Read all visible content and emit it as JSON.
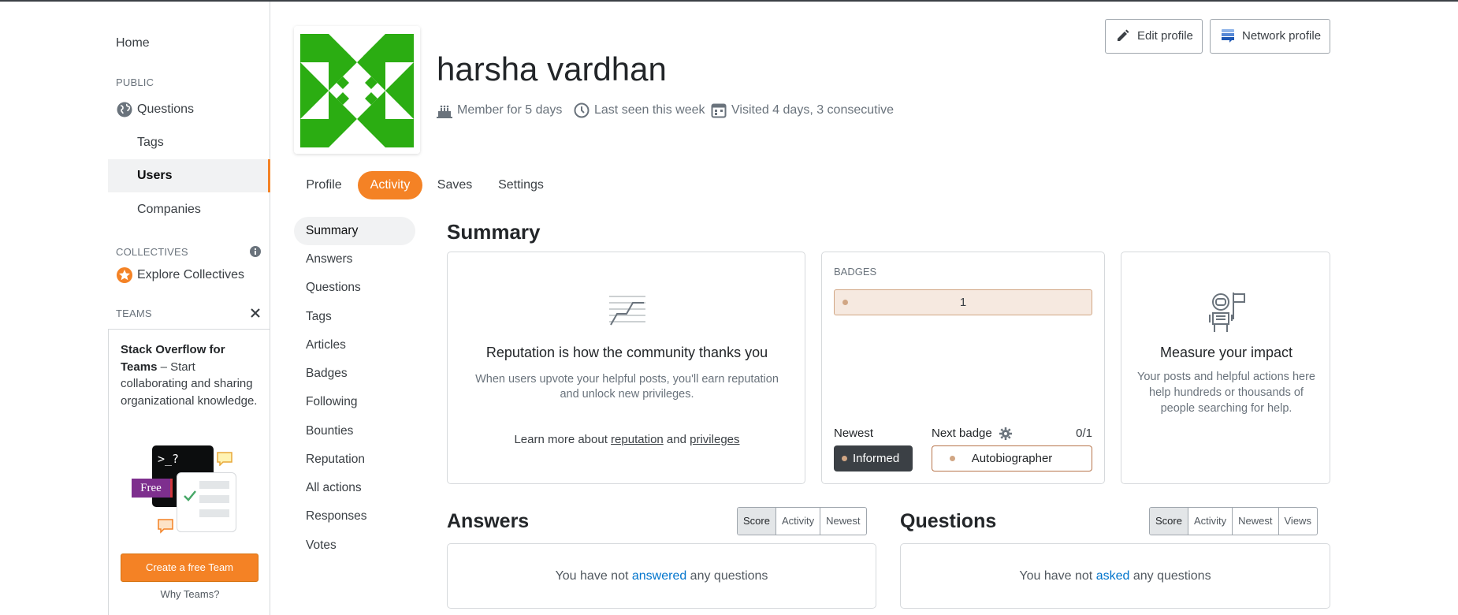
{
  "sidebar": {
    "home": "Home",
    "public_heading": "PUBLIC",
    "questions": "Questions",
    "tags": "Tags",
    "users": "Users",
    "companies": "Companies",
    "collectives_heading": "COLLECTIVES",
    "explore_collectives": "Explore Collectives",
    "teams_heading": "TEAMS",
    "teams_promo_bold": "Stack Overflow for Teams",
    "teams_promo_text": " – Start collaborating and sharing organizational knowledge.",
    "illustration_prompt": ">_?",
    "illustration_free": "Free",
    "create_team_label": "Create a free Team",
    "why_teams": "Why Teams?"
  },
  "profile": {
    "name": "harsha vardhan",
    "member_for": "Member for 5 days",
    "last_seen": "Last seen this week",
    "visited": "Visited 4 days, 3 consecutive",
    "edit_profile": "Edit profile",
    "network_profile": "Network profile"
  },
  "tabs": [
    "Profile",
    "Activity",
    "Saves",
    "Settings"
  ],
  "active_tab": "Activity",
  "subnav": [
    "Summary",
    "Answers",
    "Questions",
    "Tags",
    "Articles",
    "Badges",
    "Following",
    "Bounties",
    "Reputation",
    "All actions",
    "Responses",
    "Votes"
  ],
  "summary": {
    "title": "Summary",
    "reputation_heading": "Reputation is how the community thanks you",
    "reputation_text": "When users upvote your helpful posts, you'll earn reputation and unlock new privileges.",
    "learn_more_prefix": "Learn more about ",
    "reputation_link": "reputation",
    "and_word": " and ",
    "privileges_link": "privileges",
    "badges_heading": "BADGES",
    "bronze_count": "1",
    "newest_label": "Newest",
    "newest_badge": "Informed",
    "next_badge_label": "Next badge",
    "next_badge_progress": "0/1",
    "next_badge": "Autobiographer",
    "impact_heading": "Measure your impact",
    "impact_text": "Your posts and helpful actions here help hundreds or thousands of people searching for help."
  },
  "answers": {
    "title": "Answers",
    "sort": [
      "Score",
      "Activity",
      "Newest"
    ],
    "empty_prefix": "You have not ",
    "empty_link": "answered",
    "empty_suffix": " any questions"
  },
  "questions": {
    "title": "Questions",
    "sort": [
      "Score",
      "Activity",
      "Newest",
      "Views"
    ],
    "empty_prefix": "You have not ",
    "empty_link": "asked",
    "empty_suffix": " any questions"
  },
  "colors": {
    "accent": "#f48225",
    "link": "#0074cc",
    "avatar_green": "#2bad12",
    "bronze": "#d1a684"
  }
}
